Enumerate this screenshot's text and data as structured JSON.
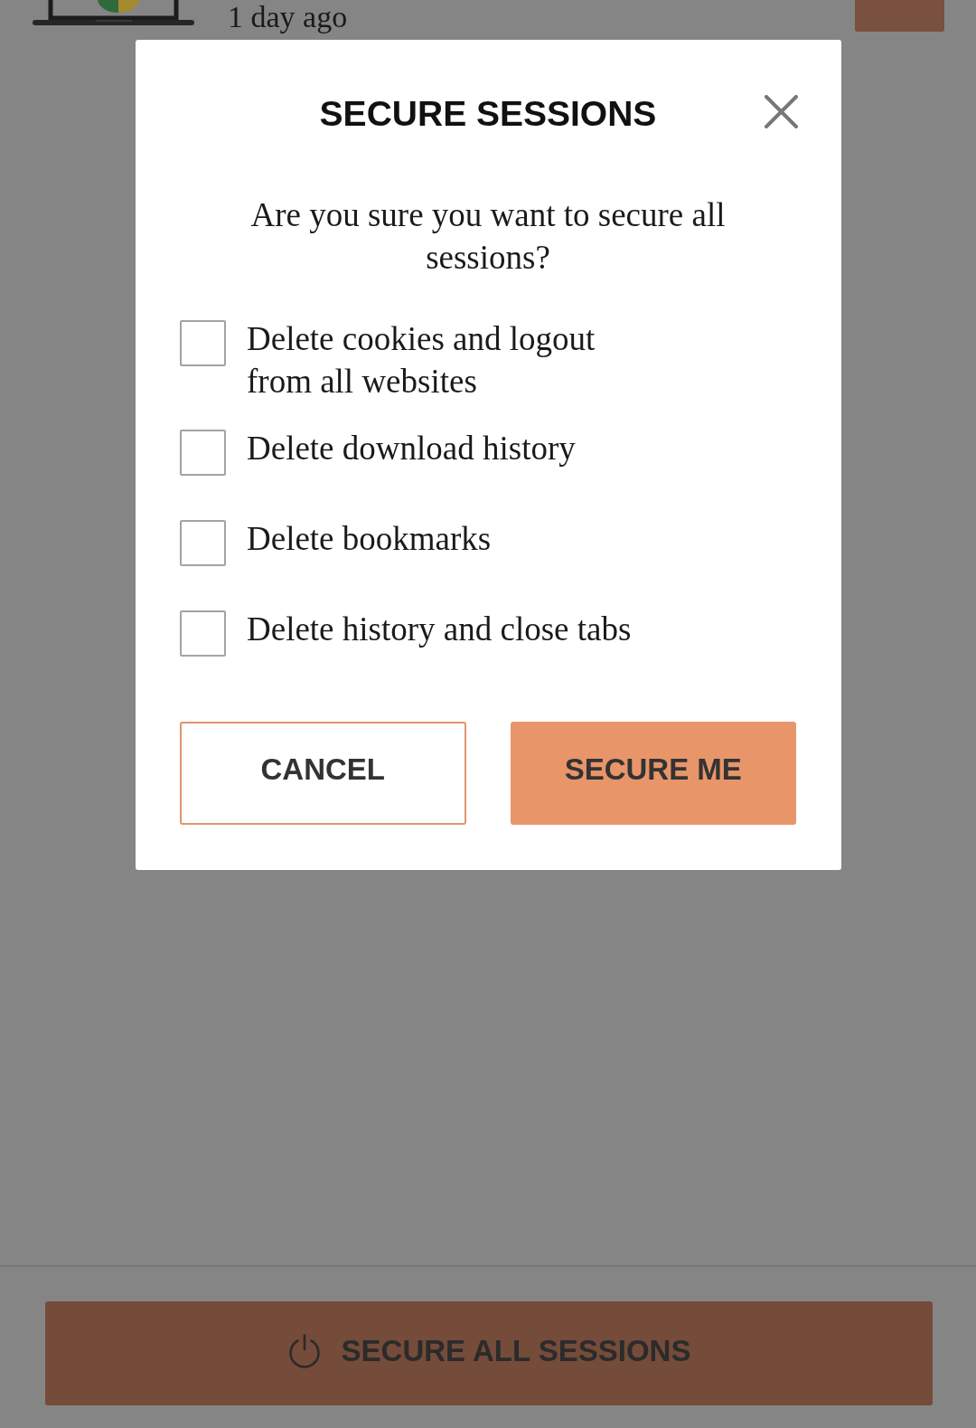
{
  "page": {
    "device": {
      "last_active": "1 day ago"
    },
    "secure_all_button": {
      "label": "SECURE ALL SESSIONS"
    }
  },
  "dialog": {
    "title": "SECURE SESSIONS",
    "message": "Are you sure you want to secure all sessions?",
    "options": [
      {
        "label": "Delete cookies and logout from all websites",
        "checked": false
      },
      {
        "label": "Delete download history",
        "checked": false
      },
      {
        "label": "Delete bookmarks",
        "checked": false
      },
      {
        "label": "Delete history and close tabs",
        "checked": false
      }
    ],
    "buttons": [
      {
        "label": "CANCEL",
        "kind": "secondary"
      },
      {
        "label": "SECURE ME",
        "kind": "primary"
      }
    ]
  }
}
